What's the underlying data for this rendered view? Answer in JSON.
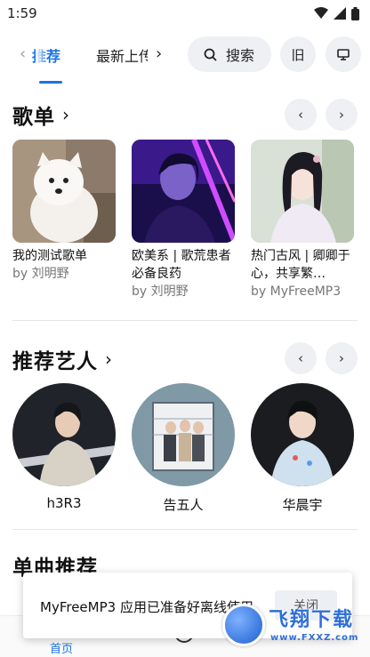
{
  "status_bar": {
    "time": "1:59"
  },
  "top_nav": {
    "tabs": [
      {
        "label": "推荐",
        "active": true
      },
      {
        "label": "最新上传",
        "active": false
      }
    ],
    "search_label": "搜索",
    "history_button_label": "旧"
  },
  "playlists": {
    "title": "歌单",
    "items": [
      {
        "name": "我的测试歌单",
        "author": "by 刘明野"
      },
      {
        "name": "欧美系 | 歌荒患者必备良药",
        "author": "by 刘明野"
      },
      {
        "name": "热门古风 | 卿卿于心，共享繁…",
        "author": "by MyFreeMP3"
      }
    ]
  },
  "artists": {
    "title": "推荐艺人",
    "items": [
      {
        "name": "h3R3"
      },
      {
        "name": "告五人"
      },
      {
        "name": "华晨宇"
      }
    ]
  },
  "singles": {
    "title": "单曲推荐"
  },
  "toast": {
    "message": "MyFreeMP3 应用已准备好离线使用",
    "close_label": "关闭"
  },
  "bottom_nav": {
    "home_label": "首页"
  },
  "watermark": {
    "text": "飞翔下载",
    "url": "www.FXXZ.com"
  },
  "colors": {
    "accent": "#1a73e8",
    "chip_bg": "#eef0f3"
  }
}
